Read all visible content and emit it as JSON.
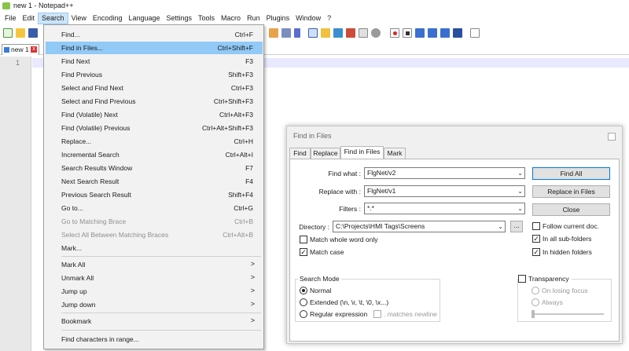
{
  "window": {
    "title": "new 1 - Notepad++"
  },
  "menubar": [
    "File",
    "Edit",
    "Search",
    "View",
    "Encoding",
    "Language",
    "Settings",
    "Tools",
    "Macro",
    "Run",
    "Plugins",
    "Window",
    "?"
  ],
  "tabs": [
    {
      "label": "new 1",
      "close": "x"
    }
  ],
  "editor": {
    "line_number": "1"
  },
  "search_menu": {
    "items": [
      {
        "label": "Find...",
        "shortcut": "Ctrl+F"
      },
      {
        "label": "Find in Files...",
        "shortcut": "Ctrl+Shift+F"
      },
      {
        "label": "Find Next",
        "shortcut": "F3"
      },
      {
        "label": "Find Previous",
        "shortcut": "Shift+F3"
      },
      {
        "label": "Select and Find Next",
        "shortcut": "Ctrl+F3"
      },
      {
        "label": "Select and Find Previous",
        "shortcut": "Ctrl+Shift+F3"
      },
      {
        "label": "Find (Volatile) Next",
        "shortcut": "Ctrl+Alt+F3"
      },
      {
        "label": "Find (Volatile) Previous",
        "shortcut": "Ctrl+Alt+Shift+F3"
      },
      {
        "label": "Replace...",
        "shortcut": "Ctrl+H"
      },
      {
        "label": "Incremental Search",
        "shortcut": "Ctrl+Alt+I"
      },
      {
        "label": "Search Results Window",
        "shortcut": "F7"
      },
      {
        "label": "Next Search Result",
        "shortcut": "F4"
      },
      {
        "label": "Previous Search Result",
        "shortcut": "Shift+F4"
      },
      {
        "label": "Go to...",
        "shortcut": "Ctrl+G"
      },
      {
        "label": "Go to Matching Brace",
        "shortcut": "Ctrl+B"
      },
      {
        "label": "Select All Between Matching Braces",
        "shortcut": "Ctrl+Alt+B"
      },
      {
        "label": "Mark...",
        "shortcut": ""
      },
      {
        "label": "Mark All",
        "shortcut": ">"
      },
      {
        "label": "Unmark All",
        "shortcut": ">"
      },
      {
        "label": "Jump up",
        "shortcut": ">"
      },
      {
        "label": "Jump down",
        "shortcut": ">"
      },
      {
        "label": "Bookmark",
        "shortcut": ">"
      },
      {
        "label": "Find characters in range...",
        "shortcut": ""
      }
    ]
  },
  "find_dialog": {
    "title": "Find in Files",
    "tabs": [
      "Find",
      "Replace",
      "Find in Files",
      "Mark"
    ],
    "find_what_label": "Find what :",
    "find_what_value": "FlgNet/v2",
    "replace_with_label": "Replace with :",
    "replace_with_value": "FlgNet/v1",
    "filters_label": "Filters :",
    "filters_value": "*.*",
    "directory_label": "Directory :",
    "directory_value": "C:\\Projects\\HMI Tags\\Screens",
    "browse_label": "...",
    "buttons": {
      "find_all": "Find All",
      "replace_in_files": "Replace in Files",
      "close": "Close"
    },
    "checks": {
      "whole_word": "Match whole word only",
      "match_case": "Match case",
      "follow_doc": "Follow current doc.",
      "sub_folders": "In all sub-folders",
      "hidden_folders": "In hidden folders",
      "check_mark": "✓"
    },
    "search_mode": {
      "title": "Search Mode",
      "normal": "Normal",
      "extended": "Extended (\\n, \\r, \\t, \\0, \\x...)",
      "regex": "Regular expression",
      "matches_newline": ". matches newline"
    },
    "transparency": {
      "title": "Transparency",
      "on_losing_focus": "On losing focus",
      "always": "Always"
    }
  }
}
